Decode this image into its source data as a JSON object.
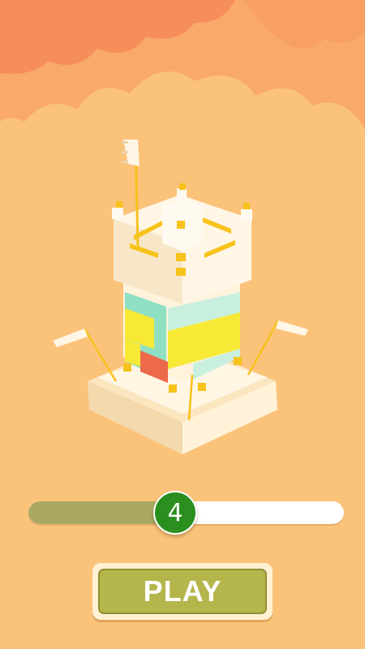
{
  "game": {
    "level_number": "4",
    "level_progress": 0.45,
    "play_label": "PLAY"
  },
  "colors": {
    "background": "#fbc27a",
    "cloud": "#f9a96a",
    "cloud_top": "#f68e5b",
    "tower_stone": "#fff3dc",
    "tower_shade": "#f3ddb6",
    "block_yellow": "#f7e936",
    "block_mint": "#8fe0c2",
    "block_red": "#ec6a4a",
    "gold": "#f7c21a",
    "progress_fill": "#a8a862",
    "knob": "#2a8f1f",
    "play_button": "#b4b64c"
  },
  "icons": [
    "castle-tower-illustration",
    "flag-icon",
    "pennant-icon"
  ]
}
